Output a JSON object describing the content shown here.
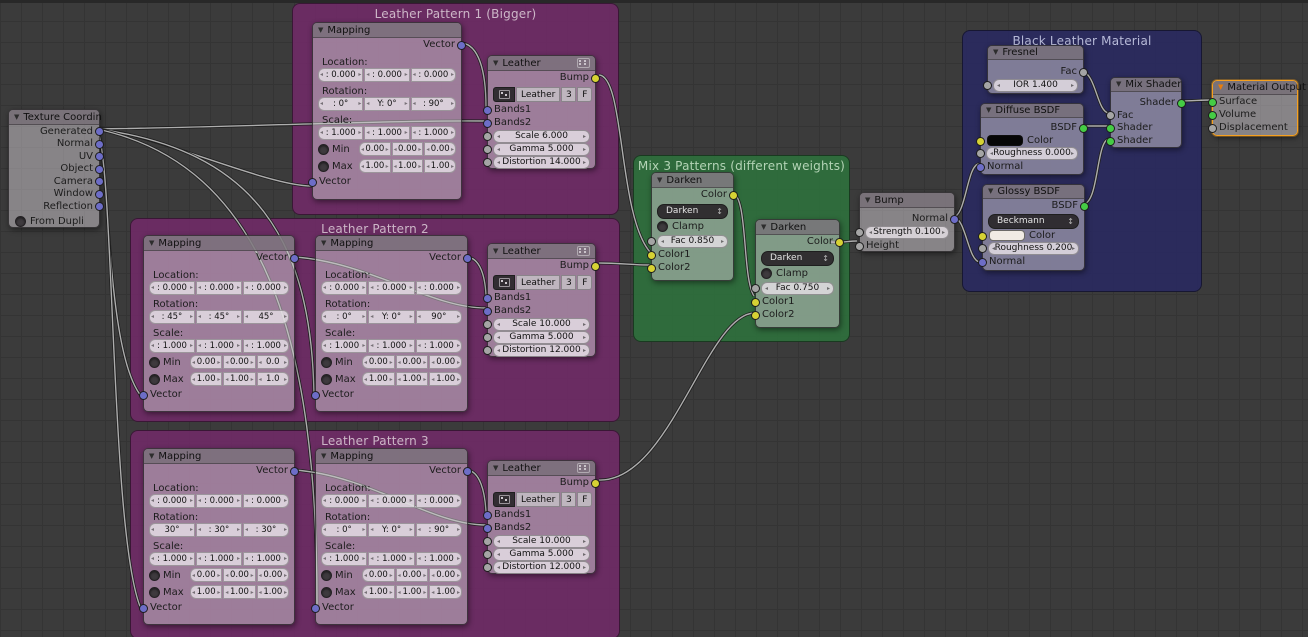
{
  "frames": {
    "pattern1": {
      "title": "Leather Pattern 1 (Bigger)"
    },
    "pattern2": {
      "title": "Leather Pattern 2"
    },
    "pattern3": {
      "title": "Leather Pattern 3"
    },
    "mix": {
      "title": "Mix 3 Patterns (different weights)"
    },
    "material": {
      "title": "Black Leather Material"
    }
  },
  "texcoord": {
    "title": "Texture Coordin",
    "outputs": [
      "Generated",
      "Normal",
      "UV",
      "Object",
      "Camera",
      "Window",
      "Reflection"
    ],
    "from_dupli": "From Dupli"
  },
  "mapping": {
    "title": "Mapping",
    "vector": "Vector",
    "location_label": "Location:",
    "rotation_label": "Rotation:",
    "scale_label": "Scale:",
    "min_label": "Min",
    "max_label": "Max",
    "p1": {
      "loc": [
        ": 0.000",
        ": 0.000",
        ": 0.000"
      ],
      "rot": [
        ": 0°",
        "Y: 0°",
        ": 90°"
      ],
      "scl": [
        ": 1.000",
        ": 1.000",
        ": 1.000"
      ],
      "min": [
        "0.00",
        "0.00",
        "0.00"
      ],
      "max": [
        "1.00",
        "1.00",
        "1.00"
      ]
    },
    "p2a": {
      "loc": [
        ": 0.000",
        ": 0.000",
        ": 0.000"
      ],
      "rot": [
        ": 45°",
        ": 45°",
        "45°"
      ],
      "scl": [
        ": 1.000",
        ": 1.000",
        ": 1.000"
      ],
      "min": [
        "0.00",
        "0.00",
        "0.0"
      ],
      "max": [
        "1.00",
        "1.00",
        "1.0"
      ]
    },
    "p2b": {
      "loc": [
        ": 0.000",
        ": 0.000",
        ": 0.000"
      ],
      "rot": [
        ": 0°",
        "Y: 0°",
        "90°"
      ],
      "scl": [
        ": 1.000",
        ": 1.000",
        ": 1.000"
      ],
      "min": [
        "0.00",
        "0.00",
        "0.00"
      ],
      "max": [
        "1.00",
        "1.00",
        "1.00"
      ]
    },
    "p3a": {
      "loc": [
        ": 0.000",
        ": 0.000",
        ": 0.000"
      ],
      "rot": [
        "30°",
        ": 30°",
        ": 30°"
      ],
      "scl": [
        ": 1.000",
        ": 1.000",
        ": 1.000"
      ],
      "min": [
        "0.00",
        "0.00",
        "0.00"
      ],
      "max": [
        "1.00",
        "1.00",
        "1.00"
      ]
    },
    "p3b": {
      "loc": [
        ": 0.000",
        ": 0.000",
        ": 0.000"
      ],
      "rot": [
        ": 0°",
        "Y: 0°",
        ": 90°"
      ],
      "scl": [
        ": 1.000",
        ": 1.000",
        ": 1.000"
      ],
      "min": [
        "0.00",
        "0.00",
        "0.00"
      ],
      "max": [
        "1.00",
        "1.00",
        "1.00"
      ]
    }
  },
  "leather": {
    "title": "Leather",
    "bump": "Bump",
    "name": "Leather",
    "users": "3",
    "fake": "F",
    "bands1": "Bands1",
    "bands2": "Bands2",
    "l1": {
      "scale": "Scale 6.000",
      "gamma": "Gamma 5.000",
      "distortion": "Distortion 14.000"
    },
    "l2": {
      "scale": "Scale 10.000",
      "gamma": "Gamma 5.000",
      "distortion": "Distortion 12.000"
    },
    "l3": {
      "scale": "Scale 10.000",
      "gamma": "Gamma 5.000",
      "distortion": "Distortion 12.000"
    }
  },
  "darken": {
    "title": "Darken",
    "color_out": "Color",
    "blend": "Darken",
    "clamp": "Clamp",
    "color1": "Color1",
    "color2": "Color2",
    "d1": {
      "fac": "Fac 0.850"
    },
    "d2": {
      "fac": "Fac 0.750"
    }
  },
  "bump": {
    "title": "Bump",
    "normal": "Normal",
    "strength": "Strength 0.100",
    "height": "Height"
  },
  "fresnel": {
    "title": "Fresnel",
    "fac": "Fac",
    "ior": "IOR 1.400"
  },
  "diffuse": {
    "title": "Diffuse BSDF",
    "bsdf": "BSDF",
    "color": "Color",
    "roughness": "Roughness 0.000",
    "normal": "Normal",
    "color_value": "#060606"
  },
  "glossy": {
    "title": "Glossy BSDF",
    "bsdf": "BSDF",
    "distribution": "Beckmann",
    "color": "Color",
    "roughness": "Roughness 0.200",
    "normal": "Normal",
    "color_value": "#f1ebe4"
  },
  "mix_shader": {
    "title": "Mix Shader",
    "shader_out": "Shader",
    "fac": "Fac",
    "shader1": "Shader",
    "shader2": "Shader"
  },
  "material_output": {
    "title": "Material Output",
    "surface": "Surface",
    "volume": "Volume",
    "displacement": "Displacement"
  },
  "colors": {
    "frame_purple": "#6d2b64",
    "frame_green": "#2e6e3c",
    "frame_blue": "#2a2a5e",
    "socket_vector": "#6d6dc7",
    "socket_color": "#d6d234",
    "socket_shader": "#45cc45",
    "socket_value": "#a5a5a5",
    "selection_outline": "#f5a020",
    "background": "#3b3b3b"
  }
}
